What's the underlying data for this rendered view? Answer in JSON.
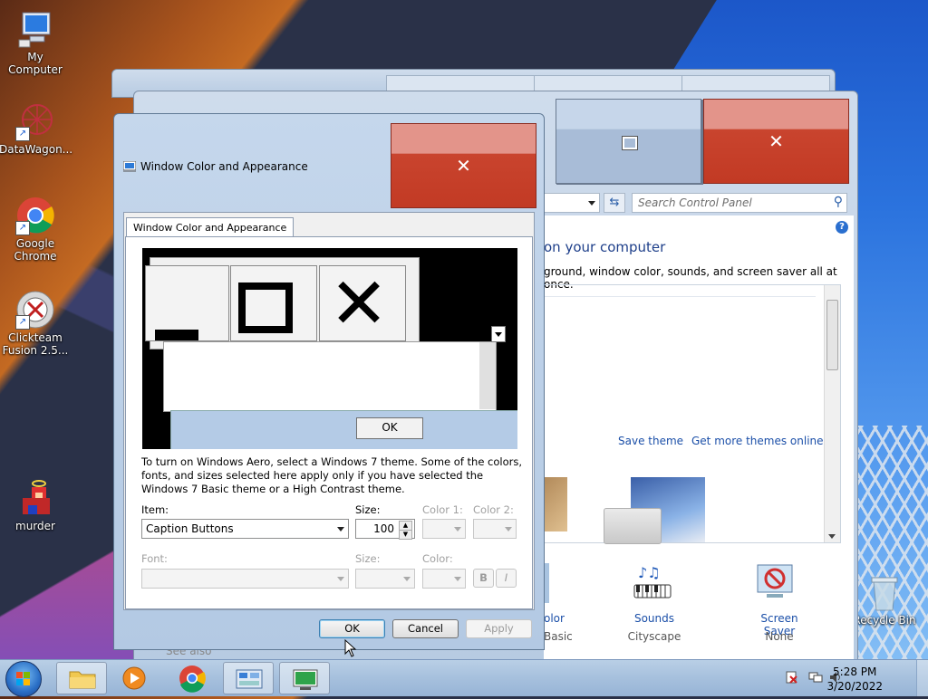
{
  "desktop": {
    "icons": [
      {
        "label": "My Computer",
        "icon": "computer-icon"
      },
      {
        "label": "DataWagon...",
        "icon": "datawagon-icon"
      },
      {
        "label": "Google Chrome",
        "icon": "chrome-icon"
      },
      {
        "label": "Clickteam Fusion 2.5...",
        "icon": "clickteam-icon"
      },
      {
        "label": "murder",
        "icon": "game-icon"
      },
      {
        "label": "Recycle Bin",
        "icon": "recycle-bin-icon"
      }
    ]
  },
  "control_panel": {
    "search_placeholder": "Search Control Panel",
    "heading": "on your computer",
    "subheading": "ground, window color, sounds, and screen saver all at once.",
    "save_theme": "Save theme",
    "get_more_themes": "Get more themes online",
    "see_also": "See also",
    "bottom_items": [
      {
        "label": "olor",
        "sub": "Basic"
      },
      {
        "label": "Sounds",
        "sub": "Cityscape"
      },
      {
        "label": "Screen Saver",
        "sub": "None"
      }
    ]
  },
  "dialog": {
    "title": "Window Color and Appearance",
    "tab_label": "Window Color and Appearance",
    "preview_ok": "OK",
    "info_text": "To turn on Windows Aero, select a Windows 7 theme.  Some of the colors, fonts, and sizes selected here apply only if you have selected the Windows 7 Basic theme or a High Contrast theme.",
    "item_label": "Item:",
    "item_value": "Caption Buttons",
    "size_label": "Size:",
    "size_value": "100",
    "color1_label": "Color 1:",
    "color2_label": "Color 2:",
    "font_label": "Font:",
    "font_size_label": "Size:",
    "font_color_label": "Color:",
    "bold_label": "B",
    "italic_label": "I",
    "ok": "OK",
    "cancel": "Cancel",
    "apply": "Apply"
  },
  "taskbar": {
    "time": "5:28 PM",
    "date": "3/20/2022"
  },
  "colors": {
    "close_red": "#c23a24",
    "link_blue": "#1b4fa8",
    "title_blue": "#c5d7ec"
  }
}
